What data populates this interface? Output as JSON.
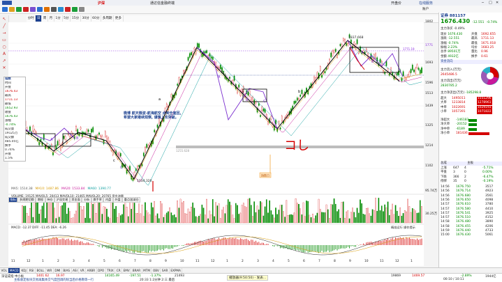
{
  "window": {
    "title": "通达信金融终端",
    "center_tag": "沪深",
    "right_tag": "开盘价",
    "app_mark": "A股",
    "account": "在线服务"
  },
  "toolbar": {
    "account_label": "账户"
  },
  "period_bar": {
    "items": [
      "分时",
      "日",
      "周",
      "月",
      "1分",
      "5分",
      "15分",
      "30分",
      "60分",
      "多周期",
      "更多"
    ],
    "active": "日"
  },
  "chart": {
    "top_price_label": "1837.668",
    "bottom_price_label": "1034.320",
    "mid_ma_label": "1255.628",
    "watermark": "1771.19",
    "annotation": "微博  航天微波-航海航空 点到全面回,\n希望大家继续观察,  谨慎上攻突破。",
    "stamp": "指数日",
    "wave_letters": [
      "a",
      "b",
      "c",
      "A",
      "B",
      "C",
      "A",
      "B",
      "C",
      "A",
      "B",
      "C"
    ],
    "red_handwrite": "コし",
    "ma_legend": [
      {
        "name": "MA5",
        "value": "1514.38",
        "color": "#5a5a5a"
      },
      {
        "name": "MA10",
        "value": "1487.86",
        "color": "#d89a00"
      },
      {
        "name": "MA20",
        "value": "1533.84",
        "color": "#c8189a"
      },
      {
        "name": "MA60",
        "value": "1390.77",
        "color": "#11a0a0"
      }
    ],
    "y_ticks": [
      "1802",
      "1771",
      "1693",
      "1596",
      "1513",
      "1439",
      "1325",
      "1214",
      "1102"
    ],
    "volume_legend": "VOLUME: 19125  MAVOL5: 20413  MAVOL10: 21465  MAVOL20: 20765  资金流量",
    "volume_ticks": [
      "95.74万",
      "30.25万"
    ],
    "macd_legend": "MACD: -12.37  DIFF: -11.45  DEA: -6.26",
    "macd_right": "精准运行  操作提示",
    "x_axis": [
      "11",
      "12",
      "1",
      "2",
      "3",
      "4",
      "5",
      "6",
      "7",
      "8",
      "9",
      "10",
      "11",
      "12",
      "1",
      "2",
      "3",
      "4",
      "5",
      "6",
      "7",
      "8",
      "9",
      "10",
      "11",
      "12",
      "1"
    ]
  },
  "sub_tabs": {
    "items": [
      "指标",
      "多周期切换",
      "期权",
      "持仓",
      "沪深交易",
      "资金面",
      "分析",
      "换手率",
      "内盘",
      "外盘",
      "重点加减仓"
    ],
    "active": "指标"
  },
  "indicator_tabs": {
    "items": [
      "VOL",
      "MACD",
      "KDJ",
      "RSI",
      "BOLL",
      "WR",
      "DMI",
      "BIAS",
      "ASI",
      "VR",
      "ARBR",
      "DPO",
      "TRIX",
      "CR",
      "EMV",
      "BRAR",
      "MTM",
      "OBV",
      "SAR",
      "EXPMA"
    ],
    "active": "MACD"
  },
  "left_info": {
    "title": "指数",
    "rows": [
      "时间",
      "开盘",
      "1676.43",
      "最高",
      "1711.13",
      "最低",
      "1652.93",
      "收盘",
      "1676.43",
      "涨幅",
      "-0.74%",
      "成交量",
      "19125万",
      "成交额",
      "485.05亿",
      "换手",
      "0.74%",
      "开盘",
      "1.5%"
    ]
  },
  "right_panel": {
    "code": "证券 881157",
    "price": "1676.430",
    "change": "-12.551",
    "pct": "-0.74%",
    "sub": "主力净买  -0.49%",
    "stats": [
      {
        "k": "现价",
        "v": "1676.430",
        "k2": "开盘",
        "v2": "1692.655"
      },
      {
        "k": "涨跌",
        "v": "-12.551",
        "k2": "最高",
        "v2": "1711.13"
      },
      {
        "k": "涨幅",
        "v": "-0.74%",
        "k2": "最低",
        "v2": "1671.018"
      },
      {
        "k": "振幅",
        "v": "2.23%",
        "k2": "均价",
        "v2": "1683.25"
      },
      {
        "k": "总手",
        "v": "89501万",
        "k2": "量比",
        "v2": "0.96"
      },
      {
        "k": "金额",
        "v": "4932亿",
        "k2": "换手",
        "v2": "0.61"
      }
    ],
    "flow_title": "主力流入(万元)",
    "flow_in": "2645486.5",
    "flow_out_title": "主力流出(万元)",
    "flow_out": "2830785.2",
    "net_title": "主力净流出(万元)",
    "net_value": "-185298.8",
    "flow_rows": [
      {
        "k": "超大",
        "in": "1495011",
        "out": "1551296"
      },
      {
        "k": "大单",
        "in": "1233814",
        "out": "1278961"
      },
      {
        "k": "中单",
        "in": "1022691",
        "out": "1029193"
      },
      {
        "k": "小单",
        "in": "1057391",
        "out": "1071822"
      }
    ],
    "net_rows": [
      {
        "k": "净超大",
        "v": "-146183"
      },
      {
        "k": "净大单",
        "v": "-20152"
      },
      {
        "k": "净中单",
        "v": "-6189"
      },
      {
        "k": "净小单",
        "v": "181436"
      }
    ],
    "table_header": [
      "",
      "总成",
      "",
      "主板"
    ],
    "table_rows": [
      {
        "k": "上涨",
        "a": "647",
        "b": "4",
        "c": "-5.71%"
      },
      {
        "k": "平盘",
        "a": "3",
        "b": "0",
        "c": "0.00%"
      },
      {
        "k": "下跌",
        "a": "366",
        "b": "2",
        "c": "-6.47%"
      },
      {
        "k": "停牌",
        "a": "35",
        "b": "0",
        "c": "-0.19%"
      }
    ],
    "ticks": [
      {
        "t": "14:56",
        "p": "1676.750",
        "v": "3517"
      },
      {
        "t": "14:56",
        "p": "1676.714",
        "v": "4923"
      },
      {
        "t": "14:56",
        "p": "1676.680",
        "v": "3561"
      },
      {
        "t": "14:56",
        "p": "1676.650",
        "v": "4098"
      },
      {
        "t": "14:57",
        "p": "1676.610",
        "v": "3780"
      },
      {
        "t": "14:57",
        "p": "1676.580",
        "v": "4410"
      },
      {
        "t": "14:57",
        "p": "1676.541",
        "v": "3925"
      },
      {
        "t": "14:57",
        "p": "1676.510",
        "v": "4152"
      },
      {
        "t": "14:58",
        "p": "1676.480",
        "v": "3890"
      },
      {
        "t": "14:58",
        "p": "1676.455",
        "v": "4206"
      },
      {
        "t": "14:59",
        "p": "1676.440",
        "v": "4733"
      },
      {
        "t": "15:00",
        "p": "1676.430",
        "v": "5061"
      }
    ]
  },
  "status": {
    "left": "深证成指  中小板",
    "quote1": "1401 62",
    "quote1b": "16.97",
    "quote2": "14165.49",
    "quote2b": "-197.51",
    "quote2c": "-1.37%",
    "quote3": "21493",
    "news": "主板收定板块交易再集体交气度回调的除当后价格勒等一行",
    "time_info": "20:33 1:2分钟 2:三 最后",
    "player": "播放器(9:50:50) - 发表...",
    "idx_right": "19869",
    "idx_right2": "1469.57",
    "bottom_right": "00:10 / 10:11",
    "pct_right": "-2.89%",
    "vol_right": "1944亿"
  },
  "colors": {
    "accent": "#1a3f8f",
    "up": "#d40000",
    "down": "#008a00",
    "wave_black": "#000000",
    "wave_purple": "#7b2fcf"
  }
}
